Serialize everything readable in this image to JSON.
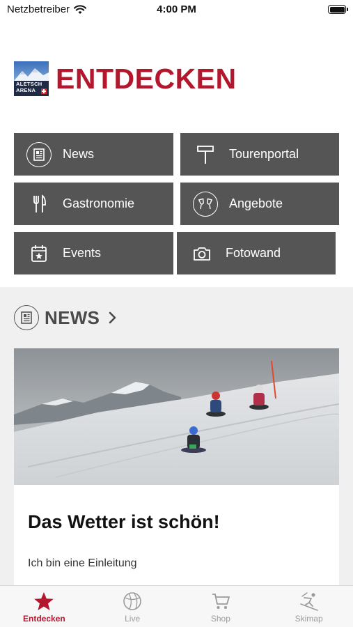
{
  "status_bar": {
    "carrier": "Netzbetreiber",
    "time": "4:00 PM"
  },
  "header": {
    "logo_text_line1": "ALETSCH",
    "logo_text_line2": "ARENA",
    "title": "ENTDECKEN"
  },
  "tiles": [
    {
      "label": "News",
      "icon": "newspaper-icon"
    },
    {
      "label": "Tourenportal",
      "icon": "signpost-icon"
    },
    {
      "label": "Gastronomie",
      "icon": "fork-knife-icon"
    },
    {
      "label": "Angebote",
      "icon": "champagne-glasses-icon"
    },
    {
      "label": "Events",
      "icon": "calendar-star-icon"
    },
    {
      "label": "Fotowand",
      "icon": "camera-icon"
    }
  ],
  "news_section": {
    "heading": "NEWS",
    "card": {
      "image": "sledding-photo",
      "title": "Das Wetter ist schön!",
      "intro": "Ich bin eine Einleitung"
    }
  },
  "tabbar": {
    "items": [
      {
        "label": "Entdecken",
        "icon": "star-icon",
        "active": true
      },
      {
        "label": "Live",
        "icon": "globe-icon",
        "active": false
      },
      {
        "label": "Shop",
        "icon": "cart-icon",
        "active": false
      },
      {
        "label": "Skimap",
        "icon": "skier-icon",
        "active": false
      }
    ]
  },
  "colors": {
    "accent": "#b3172e",
    "tile_bg": "#555555",
    "section_bg": "#f0f0f0",
    "inactive_tab": "#9a9a9a"
  }
}
